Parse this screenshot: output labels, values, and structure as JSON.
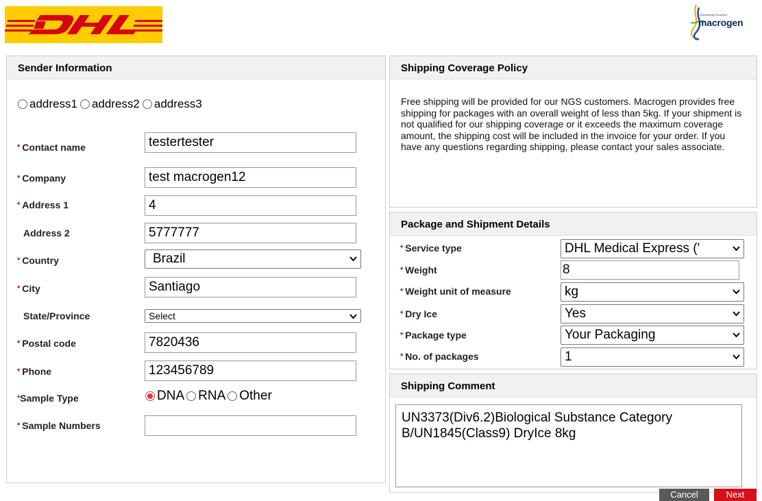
{
  "header": {
    "dhl_logo_text": "DHL",
    "macrogen_logo_text": "macrogen",
    "macrogen_tagline": "Humanizing Genomics"
  },
  "sender": {
    "title": "Sender Information",
    "address_options": [
      "address1",
      "address2",
      "address3"
    ],
    "fields": {
      "contact_name": {
        "label": "Contact name",
        "value": "testertester"
      },
      "company": {
        "label": "Company",
        "value": "test macrogen12"
      },
      "address1": {
        "label": "Address 1",
        "value": "4"
      },
      "address2": {
        "label": "Address 2",
        "value": "5777777"
      },
      "country": {
        "label": "Country",
        "value": "Brazil"
      },
      "city": {
        "label": "City",
        "value": "Santiago"
      },
      "state": {
        "label": "State/Province",
        "value": "Select"
      },
      "postal_code": {
        "label": "Postal code",
        "value": "7820436"
      },
      "phone": {
        "label": "Phone",
        "value": "123456789"
      },
      "sample_type": {
        "label": "Sample Type",
        "options": [
          "DNA",
          "RNA",
          "Other"
        ],
        "selected": "DNA"
      },
      "sample_numbers": {
        "label": "Sample Numbers",
        "value": ""
      }
    }
  },
  "policy": {
    "title": "Shipping Coverage Policy",
    "text": "Free shipping will be provided for our NGS customers. Macrogen provides free shipping for packages with an overall weight of less than 5kg. If your shipment is not qualified for our shipping coverage or it exceeds the maximum coverage amount, the shipping cost will be included in the invoice for your order. If you have any questions regarding shipping, please contact your sales associate."
  },
  "package": {
    "title": "Package and Shipment Details",
    "service_type": {
      "label": "Service type",
      "value": "DHL Medical Express ('"
    },
    "weight": {
      "label": "Weight",
      "value": "8"
    },
    "weight_unit": {
      "label": "Weight unit of measure",
      "value": "kg"
    },
    "dry_ice": {
      "label": "Dry Ice",
      "value": "Yes"
    },
    "package_type": {
      "label": "Package type",
      "value": "Your Packaging"
    },
    "num_packages": {
      "label": "No. of packages",
      "value": "1"
    }
  },
  "comment": {
    "title": "Shipping Comment",
    "value": "UN3373(Div6.2)Biological Substance Category B/UN1845(Class9) DryIce 8kg"
  },
  "footer": {
    "cancel_label": "Cancel",
    "next_label": "Next"
  },
  "colors": {
    "dhl_yellow": "#FFCC00",
    "dhl_red": "#D40511",
    "required_red": "#d0021b",
    "next_red": "#d3101c",
    "cancel_gray": "#5a5a5a",
    "radio_selected": "#e8304a"
  }
}
